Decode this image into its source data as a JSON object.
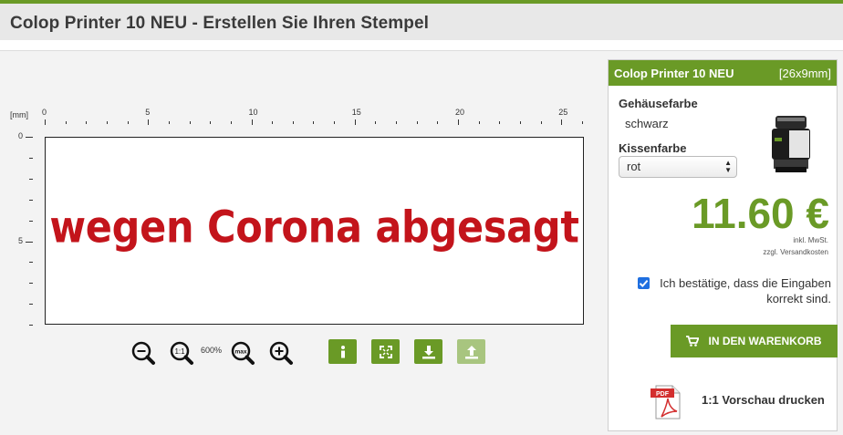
{
  "page": {
    "title": "Colop Printer 10 NEU - Erstellen Sie Ihren Stempel"
  },
  "ruler": {
    "unit": "[mm]",
    "horizontal_labels": [
      "0",
      "5",
      "10",
      "15",
      "20",
      "25"
    ],
    "vertical_labels": [
      "0",
      "5"
    ]
  },
  "stamp": {
    "text": "wegen Corona abgesagt",
    "ink_color": "#c3141b"
  },
  "toolbar": {
    "zoom_out_icon": "zoom-out-icon",
    "zoom_1_1_label": "1:1",
    "zoom_percent": "600%",
    "zoom_max_label": "max",
    "zoom_in_icon": "zoom-in-icon",
    "buttons": [
      "info-icon",
      "fullscreen-icon",
      "download-icon",
      "upload-icon"
    ]
  },
  "panel": {
    "product_name": "Colop Printer 10 NEU",
    "product_size": "[26x9mm]",
    "housing_color_label": "Gehäusefarbe",
    "housing_color_value": "schwarz",
    "pad_color_label": "Kissenfarbe",
    "pad_color_value": "rot",
    "price": "11.60 €",
    "tax_note": "inkl. MwSt.",
    "shipping_note": "zzgl. Versandkosten",
    "confirm_text": "Ich bestätige, dass die Eingaben korrekt sind.",
    "confirm_checked": true,
    "cart_button_label": "IN DEN WARENKORB",
    "pdf_label": "1:1 Vorschau drucken"
  },
  "colors": {
    "accent": "#6a9a26",
    "checkbox": "#1f6fe0"
  }
}
